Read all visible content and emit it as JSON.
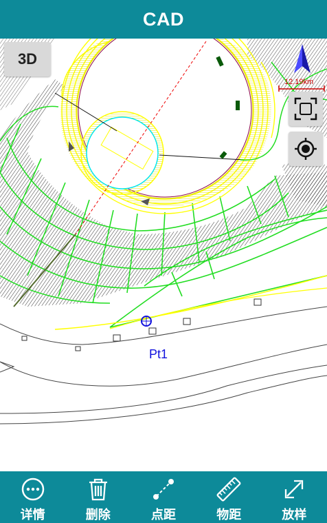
{
  "header": {
    "title": "CAD"
  },
  "map": {
    "view_mode_label": "3D",
    "scale_label": "12.19km",
    "point_label": "Pt1",
    "compass_icon": "north-arrow-icon",
    "tools": [
      {
        "name": "fit-extents",
        "icon": "fullscreen-frame-icon"
      },
      {
        "name": "locate",
        "icon": "crosshair-locate-icon"
      }
    ]
  },
  "bottom_bar": {
    "items": [
      {
        "label": "详情",
        "icon": "more-dots-icon"
      },
      {
        "label": "删除",
        "icon": "trash-icon"
      },
      {
        "label": "点距",
        "icon": "point-distance-icon"
      },
      {
        "label": "物距",
        "icon": "ruler-icon"
      },
      {
        "label": "放样",
        "icon": "expand-arrows-icon"
      }
    ]
  },
  "colors": {
    "bar": "#0d8a99",
    "cad_yellow": "#ffff00",
    "cad_green": "#22dd22",
    "cad_cyan": "#00e5ee",
    "cad_red": "#ee0000",
    "point_blue": "#1010dd"
  }
}
